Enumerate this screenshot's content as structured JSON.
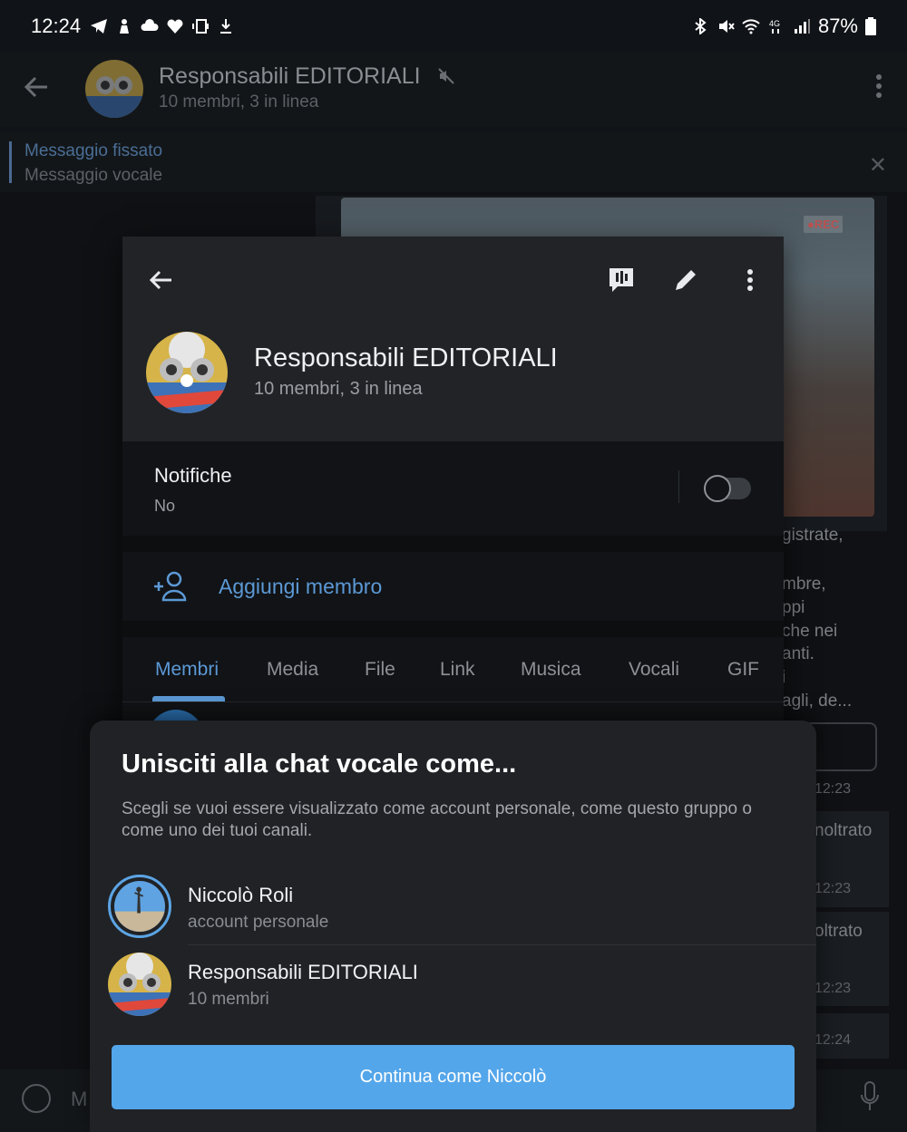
{
  "status_bar": {
    "time": "12:24",
    "battery": "87%",
    "left_icons": [
      "telegram-icon",
      "person-icon",
      "cloud-icon",
      "heart-icon",
      "screen-icon",
      "download-icon"
    ],
    "right_icons": [
      "bluetooth-icon",
      "mute-icon",
      "wifi-icon",
      "4g-icon",
      "signal-icon",
      "battery-icon"
    ]
  },
  "chat_header": {
    "title": "Responsabili EDITORIALI",
    "subtitle": "10 membri, 3 in linea"
  },
  "pinned": {
    "title": "Messaggio fissato",
    "subtitle": "Messaggio vocale"
  },
  "background_fragments": {
    "f1": "gistrate,",
    "f2": "mbre,",
    "f3": "ppi",
    "f4": "che nei",
    "f5": "anti.",
    "f6": "i",
    "f7": "agli, de...",
    "f8": "noltrato",
    "f9": "oltrato",
    "t1": "12:23",
    "t2": "12:23",
    "t3": "12:23",
    "t4": "12:24",
    "rec": "●REC",
    "input_initial": "M"
  },
  "info_panel": {
    "title": "Responsabili EDITORIALI",
    "subtitle": "10 membri, 3 in linea",
    "notifications_label": "Notifiche",
    "notifications_value": "No",
    "notifications_enabled": false,
    "add_member": "Aggiungi membro",
    "tabs": [
      "Membri",
      "Media",
      "File",
      "Link",
      "Musica",
      "Vocali",
      "GIF"
    ],
    "active_tab": "Membri"
  },
  "sheet": {
    "title": "Unisciti alla chat vocale come...",
    "description": "Scegli se vuoi essere visualizzato come account personale, come questo gruppo o come uno dei tuoi canali.",
    "options": [
      {
        "name": "Niccolò Roli",
        "sub": "account personale",
        "selected": true
      },
      {
        "name": "Responsabili EDITORIALI",
        "sub": "10 membri",
        "selected": false
      }
    ],
    "continue_label": "Continua come Niccolò"
  },
  "colors": {
    "accent": "#5c99d6",
    "button": "#54a6ea",
    "sheet_bg": "#202226",
    "panel_bg": "#111316"
  }
}
